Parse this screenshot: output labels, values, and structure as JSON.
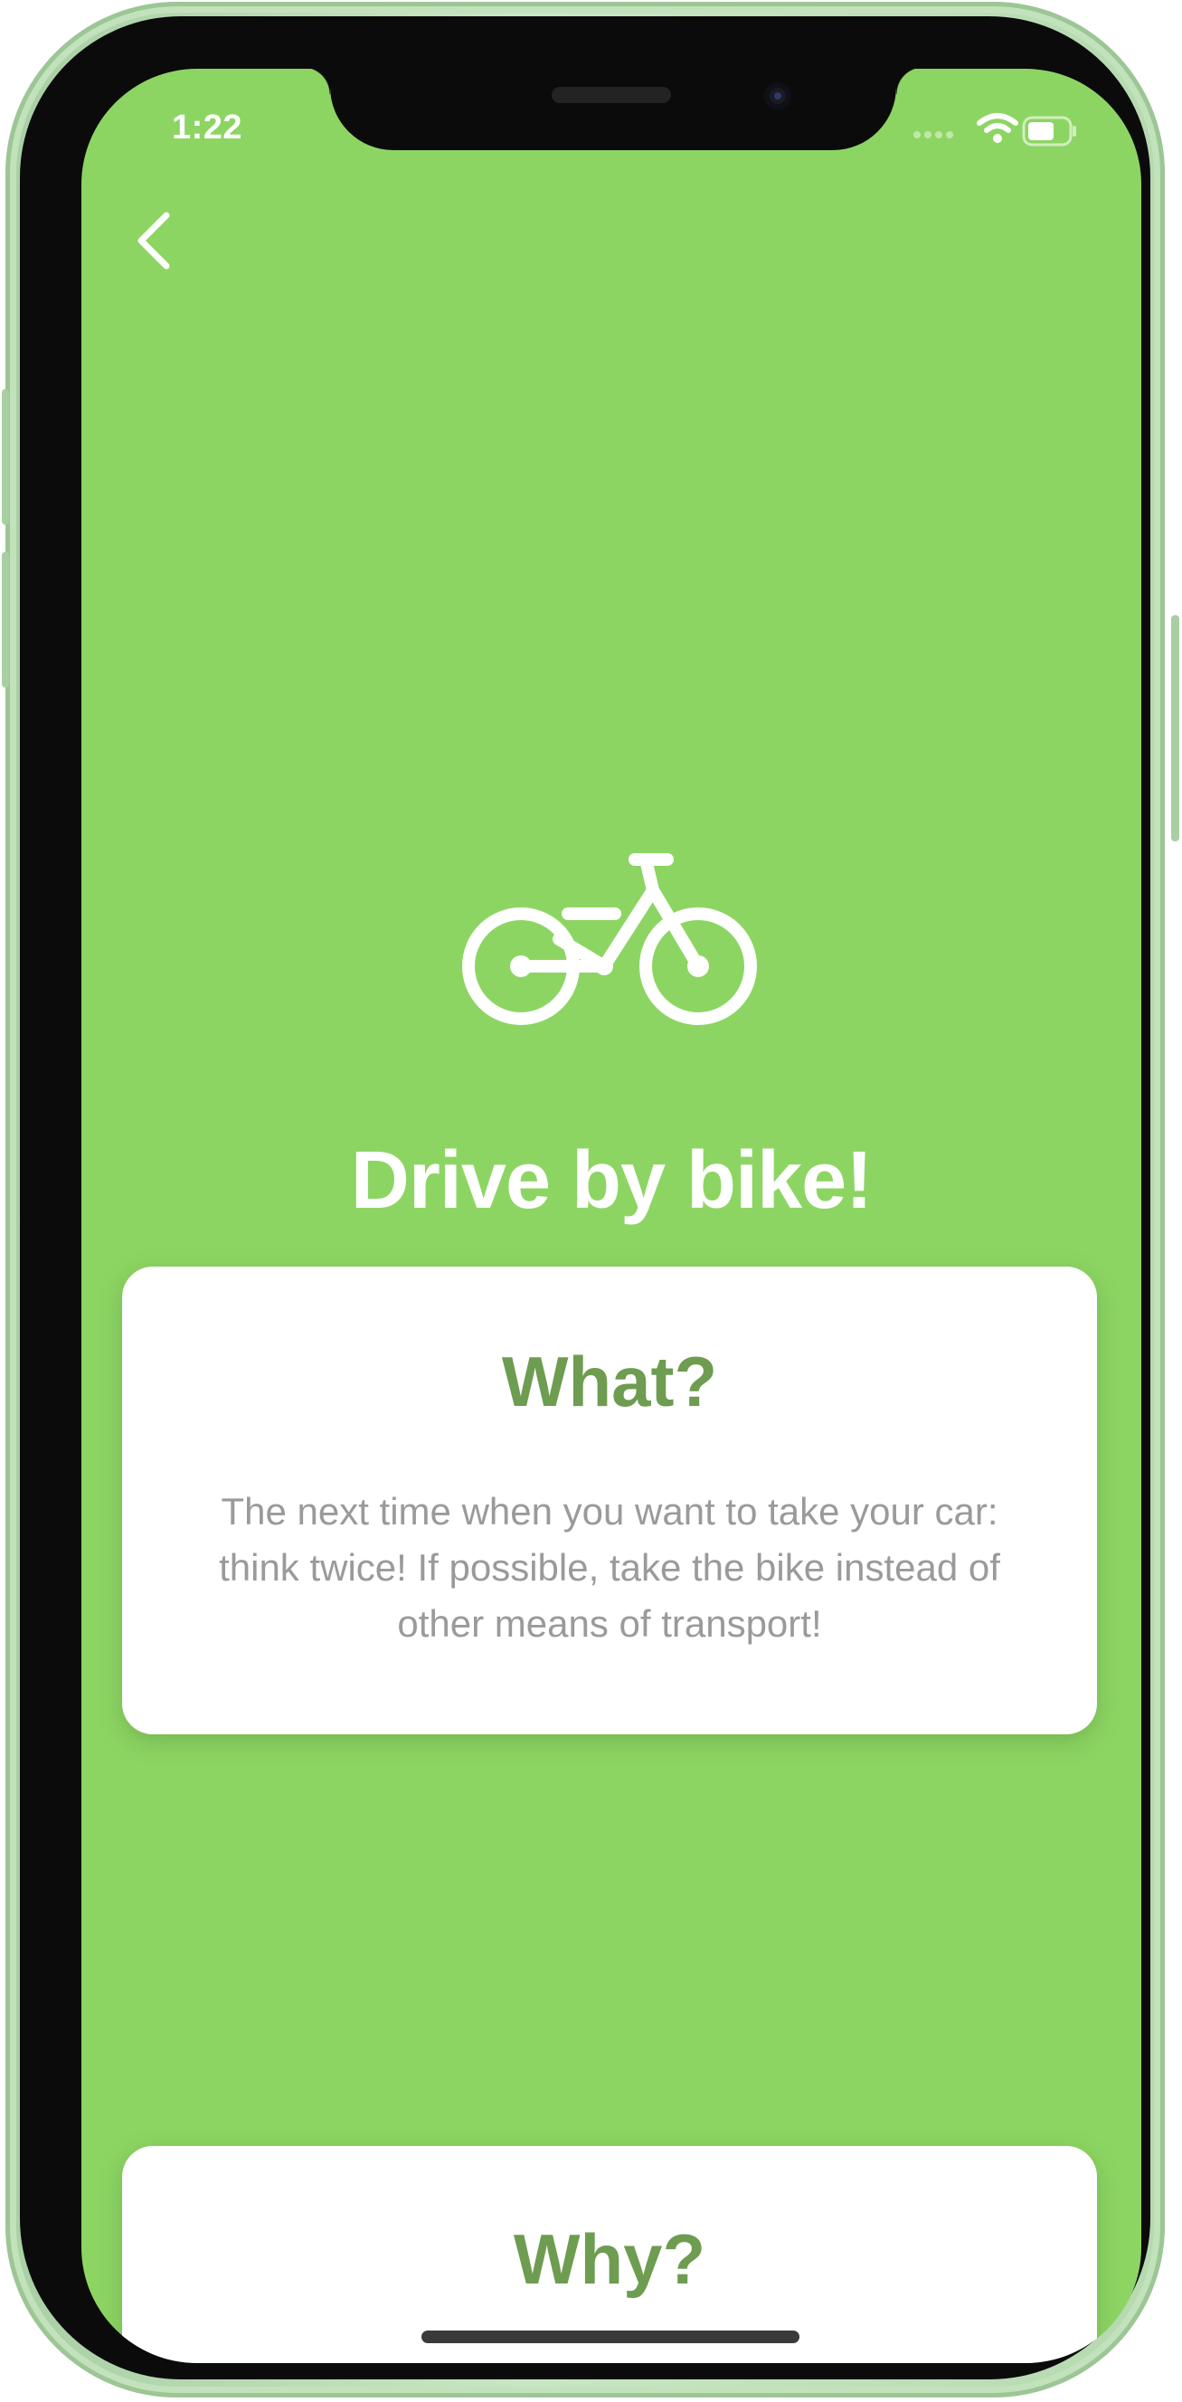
{
  "status_bar": {
    "time": "1:22",
    "icons": [
      "signal-dots-icon",
      "wifi-icon",
      "battery-icon"
    ]
  },
  "nav": {
    "back_icon": "chevron-left-icon"
  },
  "hero": {
    "icon": "bicycle-icon",
    "title": "Drive by bike!"
  },
  "cards": [
    {
      "title": "What?",
      "body": "The next time when you want to take your car: think twice! If possible, take the bike instead of other means of transport!"
    },
    {
      "title": "Why?"
    }
  ],
  "colors": {
    "background": "#8dd563",
    "card": "#ffffff",
    "card_title": "#6e9c50",
    "card_body": "#9a9a9a",
    "phone_frame": "#b6d9b0"
  }
}
